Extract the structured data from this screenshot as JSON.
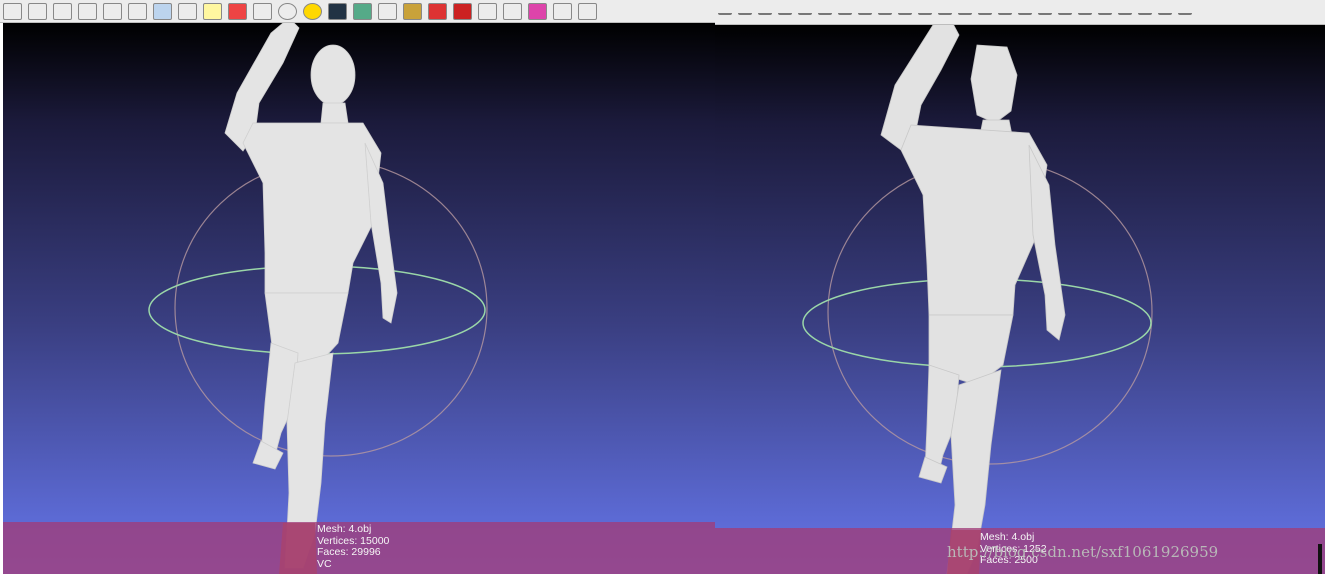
{
  "toolbar_icons": [
    "open-file-icon",
    "save-icon",
    "layer-icon",
    "points-icon",
    "wireframe-icon",
    "flat-shading-icon",
    "smooth-shading-icon",
    "texture-icon",
    "light-icon",
    "color-icon",
    "bounding-box-icon",
    "trackball-icon",
    "annotation-icon",
    "snapshot-icon",
    "filter-icon",
    "axis-icon",
    "measure-icon",
    "paint-icon",
    "quality-icon",
    "select-icon",
    "select-vertices-icon",
    "color-picker-icon",
    "reference-icon",
    "pick-icon"
  ],
  "left_view": {
    "info": {
      "mesh": "Mesh: 4.obj",
      "vertices": "Vertices: 15000",
      "faces": "Faces: 29996",
      "extra": "VC"
    }
  },
  "right_view": {
    "info": {
      "mesh": "Mesh: 4.obj",
      "vertices": "Vertices: 1252",
      "faces": "Faces: 2500"
    },
    "watermark": "http://blog.csdn.net/sxf1061926959"
  },
  "colors": {
    "background_top": "#000000",
    "background_bottom": "#6a73e0",
    "info_bar": "#a03c78",
    "mesh": "#e6e6e6",
    "trackball_horizontal": "#9ad6a8",
    "trackball_vertical": "#b89aa0"
  }
}
